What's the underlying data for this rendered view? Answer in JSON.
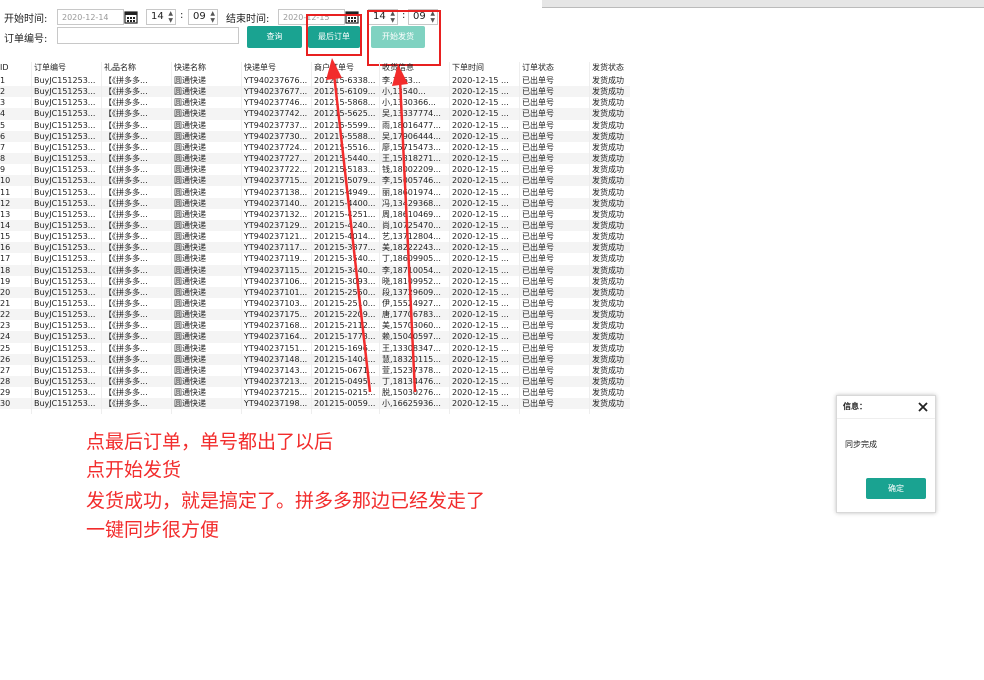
{
  "filters": {
    "start_label": "开始时间:",
    "start_date": "2020-12-14",
    "start_hour": "14",
    "start_minute": "09",
    "end_label": "结束时间:",
    "end_date": "2020-12-15",
    "end_hour": "14",
    "end_minute": "09",
    "order_no_label": "订单编号:",
    "order_no_value": "",
    "colon": ":"
  },
  "buttons": {
    "query": "查询",
    "last_order": "最后订单",
    "start_ship": "开始发货"
  },
  "table": {
    "headers": [
      "ID",
      "订单编号",
      "礼品名称",
      "快递名称",
      "快递单号",
      "商户订单号",
      "收货信息",
      "下单时间",
      "订单状态",
      "发货状态"
    ],
    "rows": [
      [
        "1",
        "BuyJC151253...",
        "【《拼多多...",
        "圆通快递",
        "YT940237676...",
        "201215-6338...",
        "李,1763...",
        "2020-12-15 ...",
        "已出单号",
        "发货成功"
      ],
      [
        "2",
        "BuyJC151253...",
        "【《拼多多...",
        "圆通快递",
        "YT940237677...",
        "201215-6109...",
        "小,13540...",
        "2020-12-15 ...",
        "已出单号",
        "发货成功"
      ],
      [
        "3",
        "BuyJC151253...",
        "【《拼多多...",
        "圆通快递",
        "YT940237746...",
        "201215-5868...",
        "小,1330366...",
        "2020-12-15 ...",
        "已出单号",
        "发货成功"
      ],
      [
        "4",
        "BuyJC151253...",
        "【《拼多多...",
        "圆通快递",
        "YT940237742...",
        "201215-5625...",
        "吴,13337774...",
        "2020-12-15 ...",
        "已出单号",
        "发货成功"
      ],
      [
        "5",
        "BuyJC151253...",
        "【《拼多多...",
        "圆通快递",
        "YT940237737...",
        "201215-5599...",
        "雨,18016477...",
        "2020-12-15 ...",
        "已出单号",
        "发货成功"
      ],
      [
        "6",
        "BuyJC151253...",
        "【《拼多多...",
        "圆通快递",
        "YT940237730...",
        "201215-5588...",
        "吴,17906444...",
        "2020-12-15 ...",
        "已出单号",
        "发货成功"
      ],
      [
        "7",
        "BuyJC151253...",
        "【《拼多多...",
        "圆通快递",
        "YT940237724...",
        "201215-5516...",
        "廖,15715473...",
        "2020-12-15 ...",
        "已出单号",
        "发货成功"
      ],
      [
        "8",
        "BuyJC151253...",
        "【《拼多多...",
        "圆通快递",
        "YT940237727...",
        "201215-5440...",
        "王,15318271...",
        "2020-12-15 ...",
        "已出单号",
        "发货成功"
      ],
      [
        "9",
        "BuyJC151253...",
        "【《拼多多...",
        "圆通快递",
        "YT940237722...",
        "201215-5183...",
        "钱,18002209...",
        "2020-12-15 ...",
        "已出单号",
        "发货成功"
      ],
      [
        "10",
        "BuyJC151253...",
        "【《拼多多...",
        "圆通快递",
        "YT940237715...",
        "201215-5079...",
        "李,15005746...",
        "2020-12-15 ...",
        "已出单号",
        "发货成功"
      ],
      [
        "11",
        "BuyJC151253...",
        "【《拼多多...",
        "圆通快递",
        "YT940237138...",
        "201215-4949...",
        "丽,18601974...",
        "2020-12-15 ...",
        "已出单号",
        "发货成功"
      ],
      [
        "12",
        "BuyJC151253...",
        "【《拼多多...",
        "圆通快递",
        "YT940237140...",
        "201215-4400...",
        "冯,13429368...",
        "2020-12-15 ...",
        "已出单号",
        "发货成功"
      ],
      [
        "13",
        "BuyJC151253...",
        "【《拼多多...",
        "圆通快递",
        "YT940237132...",
        "201215-4251...",
        "周,18610469...",
        "2020-12-15 ...",
        "已出单号",
        "发货成功"
      ],
      [
        "14",
        "BuyJC151253...",
        "【《拼多多...",
        "圆通快递",
        "YT940237129...",
        "201215-4240...",
        "尚,10725470...",
        "2020-12-15 ...",
        "已出单号",
        "发货成功"
      ],
      [
        "15",
        "BuyJC151253...",
        "【《拼多多...",
        "圆通快递",
        "YT940237121...",
        "201215-4014...",
        "艺,13712804...",
        "2020-12-15 ...",
        "已出单号",
        "发货成功"
      ],
      [
        "16",
        "BuyJC151253...",
        "【《拼多多...",
        "圆通快递",
        "YT940237117...",
        "201215-3877...",
        "美,18222243...",
        "2020-12-15 ...",
        "已出单号",
        "发货成功"
      ],
      [
        "17",
        "BuyJC151253...",
        "【《拼多多...",
        "圆通快递",
        "YT940237119...",
        "201215-3540...",
        "丁,18609905...",
        "2020-12-15 ...",
        "已出单号",
        "发货成功"
      ],
      [
        "18",
        "BuyJC151253...",
        "【《拼多多...",
        "圆通快递",
        "YT940237115...",
        "201215-3440...",
        "李,18710054...",
        "2020-12-15 ...",
        "已出单号",
        "发货成功"
      ],
      [
        "19",
        "BuyJC151253...",
        "【《拼多多...",
        "圆通快递",
        "YT940237106...",
        "201215-3093...",
        "晓,18109952...",
        "2020-12-15 ...",
        "已出单号",
        "发货成功"
      ],
      [
        "20",
        "BuyJC151253...",
        "【《拼多多...",
        "圆通快递",
        "YT940237101...",
        "201215-2550...",
        "段,13729609...",
        "2020-12-15 ...",
        "已出单号",
        "发货成功"
      ],
      [
        "21",
        "BuyJC151253...",
        "【《拼多多...",
        "圆通快递",
        "YT940237103...",
        "201215-2510...",
        "伊,15524927...",
        "2020-12-15 ...",
        "已出单号",
        "发货成功"
      ],
      [
        "22",
        "BuyJC151253...",
        "【《拼多多...",
        "圆通快递",
        "YT940237175...",
        "201215-2209...",
        "唐,17706783...",
        "2020-12-15 ...",
        "已出单号",
        "发货成功"
      ],
      [
        "23",
        "BuyJC151253...",
        "【《拼多多...",
        "圆通快递",
        "YT940237168...",
        "201215-2112...",
        "美,15703060...",
        "2020-12-15 ...",
        "已出单号",
        "发货成功"
      ],
      [
        "24",
        "BuyJC151253...",
        "【《拼多多...",
        "圆通快递",
        "YT940237164...",
        "201215-1773...",
        "赖,15040597...",
        "2020-12-15 ...",
        "已出单号",
        "发货成功"
      ],
      [
        "25",
        "BuyJC151253...",
        "【《拼多多...",
        "圆通快递",
        "YT940237151...",
        "201215-1696...",
        "王,13308347...",
        "2020-12-15 ...",
        "已出单号",
        "发货成功"
      ],
      [
        "26",
        "BuyJC151253...",
        "【《拼多多...",
        "圆通快递",
        "YT940237148...",
        "201215-1404...",
        "慧,18320115...",
        "2020-12-15 ...",
        "已出单号",
        "发货成功"
      ],
      [
        "27",
        "BuyJC151253...",
        "【《拼多多...",
        "圆通快递",
        "YT940237143...",
        "201215-0671...",
        "萱,15237378...",
        "2020-12-15 ...",
        "已出单号",
        "发货成功"
      ],
      [
        "28",
        "BuyJC151253...",
        "【《拼多多...",
        "圆通快递",
        "YT940237213...",
        "201215-0495...",
        "丁,18134476...",
        "2020-12-15 ...",
        "已出单号",
        "发货成功"
      ],
      [
        "29",
        "BuyJC151253...",
        "【《拼多多...",
        "圆通快递",
        "YT940237215...",
        "201215-0215...",
        "脱,15030276...",
        "2020-12-15 ...",
        "已出单号",
        "发货成功"
      ],
      [
        "30",
        "BuyJC151253...",
        "【《拼多多...",
        "圆通快递",
        "YT940237198...",
        "201215-0059...",
        "小,16625936...",
        "2020-12-15 ...",
        "已出单号",
        "发货成功"
      ]
    ]
  },
  "annotation": {
    "lines": [
      "点最后订单，单号都出了以后",
      "点开始发货",
      "发货成功，就是搞定了。拼多多那边已经发走了",
      "一键同步很方便"
    ],
    "color": "#f22c2c"
  },
  "dialog": {
    "title": "信息：",
    "message": "同步完成",
    "confirm": "确定",
    "accent": "#1aa391"
  },
  "icons": [
    "calendar-icon",
    "spin-arrows-icon",
    "close-icon",
    "arrow-annotation"
  ]
}
